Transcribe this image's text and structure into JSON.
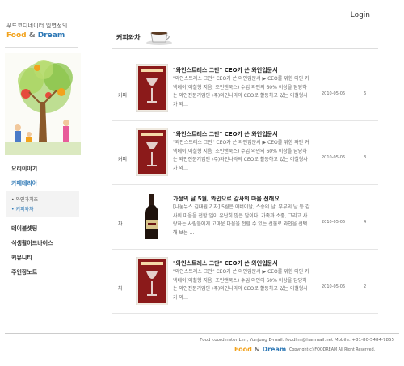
{
  "header": {
    "login_label": "Login"
  },
  "brand": {
    "subtitle": "푸드코디네이터 임연정의",
    "food": "Food",
    "amp": "&",
    "dream": "Dream"
  },
  "nav": {
    "items": [
      "요리이야기",
      "카페테리아",
      "테이블셋팅",
      "식생활어드바이스",
      "커뮤니티",
      "주인장노트"
    ],
    "subitems": [
      "• 와인과치즈",
      "• 커피와차"
    ]
  },
  "content": {
    "section_title": "커피와차",
    "rows": [
      {
        "category": "커피",
        "title": "\"와인스트레스 그만\" CEO가 쓴 와인입문서",
        "excerpt": "\"와인스트레스 그만\" CEO가 쓴 와인입문서 ▶ CEO를 위한 와인 커넥베이(이철형 지음, 조인앤북스) 수입 와인의 60% 이상을 담당하는 와인전문기업인 (주)와인나라의 CEO로 활동하고 있는 이철형사가 와…",
        "date": "2010-05-06",
        "hits": "6"
      },
      {
        "category": "커피",
        "title": "\"와인스트레스 그만\" CEO가 쓴 와인입문서",
        "excerpt": "\"와인스트레스 그만\" CEO가 쓴 와인입문서 ▶ CEO를 위한 와인 커넥베이(이철형 지음, 조인앤북스) 수입 와인의 60% 이상을 담당하는 와인전문기업인 (주)와인나라의 CEO로 활동하고 있는 이철형사가 와…",
        "date": "2010-05-06",
        "hits": "3"
      },
      {
        "category": "차",
        "title": "가정의 달 5월, 와인으로 감사의 마음 전해요",
        "excerpt": "[나눔뉴스 김대원 기자] 5월은 어버이날, 스승의 날, 부부의 날 등 감사의 마음을 전할 일이 유난히 많은 달이다. 가족과 소중, 그리고 사랑하는 사람들에게 고마운 마음을 전할 수 있는 선물로 와인을 선택해 보는 …",
        "date": "2010-05-06",
        "hits": "4"
      },
      {
        "category": "차",
        "title": "\"와인스트레스 그만\" CEO가 쓴 와인입문서",
        "excerpt": "\"와인스트레스 그만\" CEO가 쓴 와인입문서 ▶ CEO를 위한 와인 커넥베이(이철형 지음, 조인앤북스) 수입 와인의 60% 이상을 담당하는 와인전문기업인 (주)와인나라의 CEO로 활동하고 있는 이철형사가 와…",
        "date": "2010-05-06",
        "hits": "2"
      }
    ]
  },
  "footer": {
    "info": "Food coordinator Lim, Yunjung  E-mail. foodlim@hanmail.net  Mobile. +81-80-5484-7855",
    "food": "Food",
    "amp": "&",
    "dream": "Dream",
    "copyright": "Copyright(c) FOODREAM All Right Reserved."
  },
  "colors": {
    "brand_orange": "#f2a21c",
    "brand_blue": "#2f79b6"
  },
  "icons": {
    "section": "coffee-cup-icon",
    "book": "book-cover-thumbnail",
    "bottle": "wine-bottle-thumbnail"
  }
}
